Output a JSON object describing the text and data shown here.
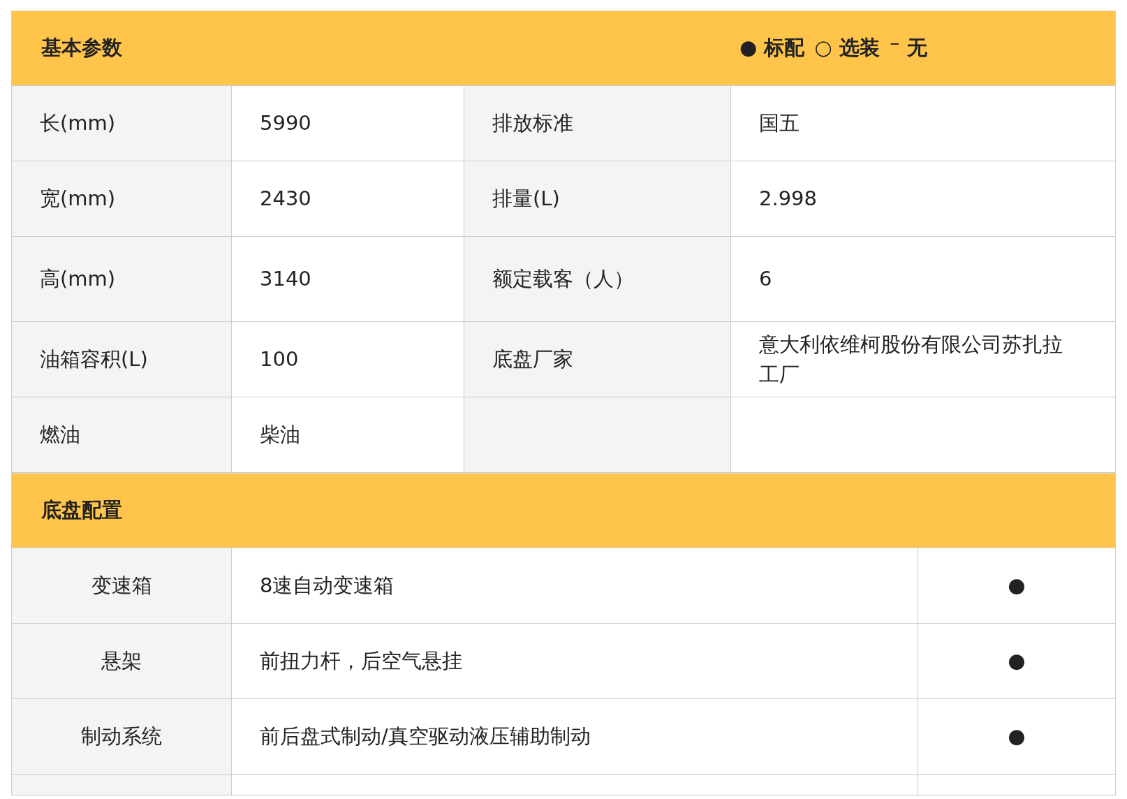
{
  "sections": [
    {
      "kind": "basic",
      "title": "基本参数",
      "legend": [
        {
          "symbol": "●",
          "label": "标配"
        },
        {
          "symbol": "○",
          "label": "选装"
        },
        {
          "symbol": "⁻",
          "label": "无"
        }
      ],
      "rows": [
        {
          "pairs": [
            {
              "label": "长(mm)",
              "value": "5990"
            },
            {
              "label": "排放标准",
              "value": "国五"
            }
          ]
        },
        {
          "pairs": [
            {
              "label": "宽(mm)",
              "value": "2430"
            },
            {
              "label": "排量(L)",
              "value": "2.998"
            }
          ]
        },
        {
          "pairs": [
            {
              "label": "高(mm)",
              "value": "3140"
            },
            {
              "label": "额定载客（人）",
              "value": "6"
            }
          ]
        },
        {
          "pairs": [
            {
              "label": "油箱容积(L)",
              "value": "100"
            },
            {
              "label": "底盘厂家",
              "value": "意大利依维柯股份有限公司苏扎拉工厂"
            }
          ]
        },
        {
          "pairs": [
            {
              "label": "燃油",
              "value": "柴油"
            }
          ]
        }
      ]
    },
    {
      "kind": "config",
      "title": "底盘配置",
      "rows": [
        {
          "label": "变速箱",
          "value": "8速自动变速箱",
          "mark": "●"
        },
        {
          "label": "悬架",
          "value": "前扭力杆，后空气悬挂",
          "mark": "●"
        },
        {
          "label": "制动系统",
          "value": "前后盘式制动/真空驱动液压辅助制动",
          "mark": "●"
        }
      ]
    }
  ]
}
